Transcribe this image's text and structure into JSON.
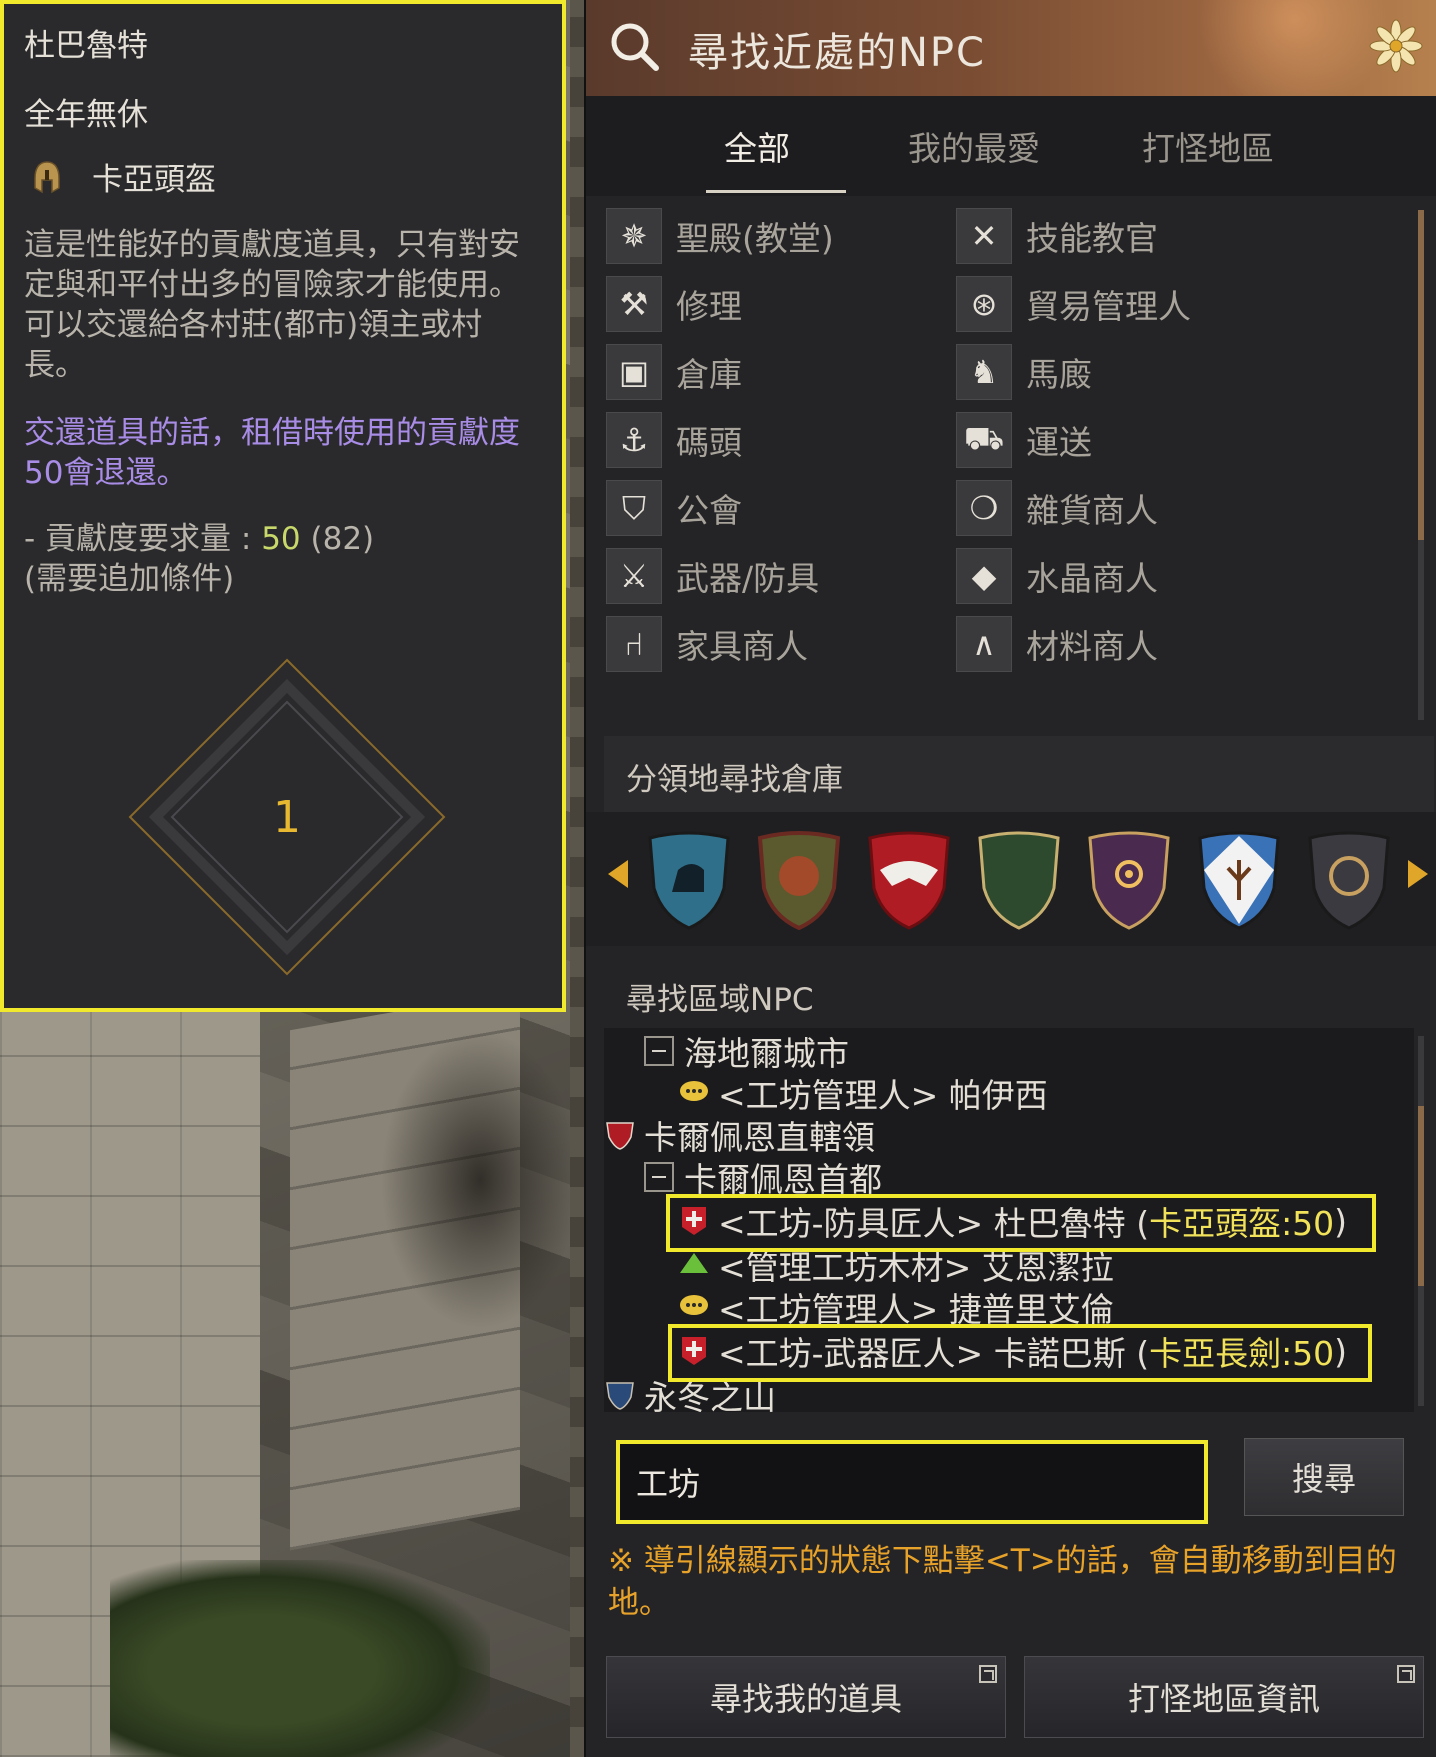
{
  "tooltip": {
    "npc_name": "杜巴魯特",
    "schedule": "全年無休",
    "item_name": "卡亞頭盔",
    "description": "這是性能好的貢獻度道具，只有對安定與和平付出多的冒險家才能使用。可以交還給各村莊(都市)領主或村長。",
    "note": "交還道具的話，租借時使用的貢獻度50會退還。",
    "requirement_prefix": "- 貢獻度要求量 : ",
    "requirement_value": "50",
    "requirement_suffix": " (82)",
    "requirement_extra": "(需要追加條件)",
    "count": "1"
  },
  "finder": {
    "title": "尋找近處的NPC",
    "tabs": [
      "全部",
      "我的最愛",
      "打怪地區"
    ],
    "categories": [
      {
        "label": "聖殿(教堂)",
        "icon": "temple-icon"
      },
      {
        "label": "技能教官",
        "icon": "crossed-axes-icon"
      },
      {
        "label": "修理",
        "icon": "anvil-icon"
      },
      {
        "label": "貿易管理人",
        "icon": "wheel-icon"
      },
      {
        "label": "倉庫",
        "icon": "chest-icon"
      },
      {
        "label": "馬廄",
        "icon": "horse-icon"
      },
      {
        "label": "碼頭",
        "icon": "anchor-icon"
      },
      {
        "label": "運送",
        "icon": "wagon-icon"
      },
      {
        "label": "公會",
        "icon": "guild-crest-icon"
      },
      {
        "label": "雜貨商人",
        "icon": "money-bag-icon"
      },
      {
        "label": "武器/防具",
        "icon": "weapon-icon"
      },
      {
        "label": "水晶商人",
        "icon": "crystal-icon"
      },
      {
        "label": "家具商人",
        "icon": "chair-icon"
      },
      {
        "label": "材料商人",
        "icon": "material-icon"
      }
    ],
    "section_storage": "分領地尋找倉庫",
    "emblems": [
      {
        "icon": "horse-shield-icon",
        "color": "#2f6f8a"
      },
      {
        "icon": "lion-shield-icon",
        "color": "#5a5a2e"
      },
      {
        "icon": "eagle-shield-icon",
        "color": "#b01c24"
      },
      {
        "icon": "moon-shield-icon",
        "color": "#2d4a2e"
      },
      {
        "icon": "eye-shield-icon",
        "color": "#4a2a4e"
      },
      {
        "icon": "tree-shield-icon",
        "color": "#3a72b8"
      },
      {
        "icon": "knot-shield-icon",
        "color": "#3a3a40"
      }
    ],
    "section_region": "尋找區域NPC",
    "tree": [
      {
        "text": "海地爾城市",
        "type": "group"
      },
      {
        "text": "<工坊管理人> 帕伊西",
        "type": "npc",
        "icon": "chat-bubble-icon"
      },
      {
        "text": "卡爾佩恩直轄領",
        "type": "region",
        "icon": "region-shield-icon"
      },
      {
        "text": "卡爾佩恩首都",
        "type": "group"
      },
      {
        "text_main": "<工坊-防具匠人> 杜巴魯特 (",
        "text_hl": "卡亞頭盔:50",
        "text_end": ")",
        "type": "npc-hl",
        "icon": "red-banner-icon"
      },
      {
        "text": "<管理工坊木材> 艾恩潔拉",
        "type": "npc",
        "icon": "tree-icon"
      },
      {
        "text": "<工坊管理人> 捷普里艾倫",
        "type": "npc",
        "icon": "chat-bubble-icon"
      },
      {
        "text_main": "<工坊-武器匠人> 卡諾巴斯 (",
        "text_hl": "卡亞長劍:50",
        "text_end": ")",
        "type": "npc-hl",
        "icon": "red-banner-icon"
      },
      {
        "text": "永冬之山",
        "type": "region",
        "icon": "blue-shield-icon"
      }
    ],
    "search_value": "工坊",
    "search_button": "搜尋",
    "hint": "※ 導引線顯示的狀態下點擊<T>的話，會自動移動到目的地。",
    "btn_my_items": "尋找我的道具",
    "btn_hunting_info": "打怪地區資訊",
    "accent_color": "#f1ea2c",
    "hint_color": "#e7a22a"
  }
}
